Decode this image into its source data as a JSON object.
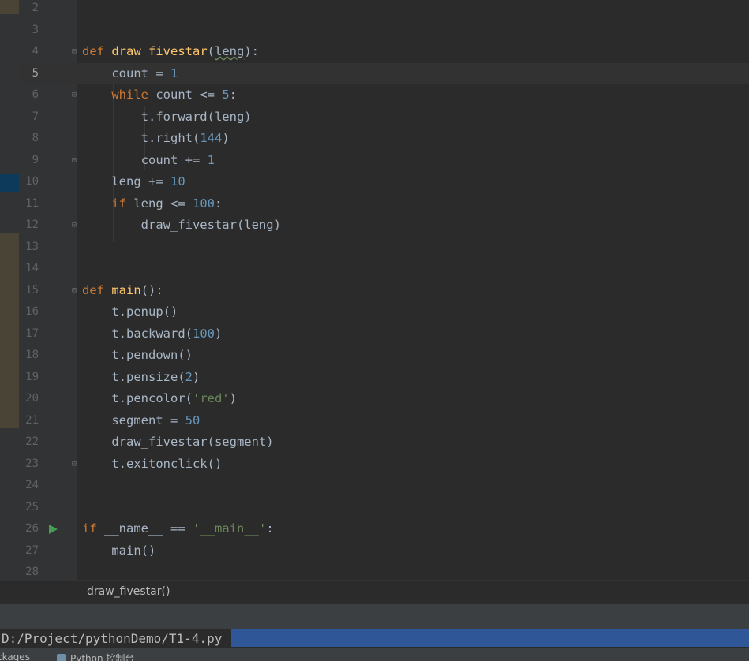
{
  "editor": {
    "current_line": "5",
    "lines": [
      {
        "num": "2"
      },
      {
        "num": "3"
      },
      {
        "num": "4",
        "t1": "def",
        "t2": " ",
        "t3": "draw_fivestar",
        "t4": "(",
        "t5": "leng",
        "t6": "):"
      },
      {
        "num": "5",
        "t1": "    count = ",
        "t2": "1"
      },
      {
        "num": "6",
        "t1": "    ",
        "t2": "while",
        "t3": " count <= ",
        "t4": "5",
        "t5": ":"
      },
      {
        "num": "7",
        "t1": "        t.forward(leng)"
      },
      {
        "num": "8",
        "t1": "        t.right(",
        "t2": "144",
        "t3": ")"
      },
      {
        "num": "9",
        "t1": "        count += ",
        "t2": "1"
      },
      {
        "num": "10",
        "t1": "    leng += ",
        "t2": "10"
      },
      {
        "num": "11",
        "t1": "    ",
        "t2": "if",
        "t3": " leng <= ",
        "t4": "100",
        "t5": ":"
      },
      {
        "num": "12",
        "t1": "        draw_fivestar(leng)"
      },
      {
        "num": "13"
      },
      {
        "num": "14"
      },
      {
        "num": "15",
        "t1": "def",
        "t2": " ",
        "t3": "main",
        "t4": "():"
      },
      {
        "num": "16",
        "t1": "    t.penup()"
      },
      {
        "num": "17",
        "t1": "    t.backward(",
        "t2": "100",
        "t3": ")"
      },
      {
        "num": "18",
        "t1": "    t.pendown()"
      },
      {
        "num": "19",
        "t1": "    t.pensize(",
        "t2": "2",
        "t3": ")"
      },
      {
        "num": "20",
        "t1": "    t.pencolor(",
        "t2": "'red'",
        "t3": ")"
      },
      {
        "num": "21",
        "t1": "    segment = ",
        "t2": "50"
      },
      {
        "num": "22",
        "t1": "    draw_fivestar(segment)"
      },
      {
        "num": "23",
        "t1": "    t.exitonclick()"
      },
      {
        "num": "24"
      },
      {
        "num": "25"
      },
      {
        "num": "26",
        "t1": "if",
        "t2": " __name__ == ",
        "t3": "'__main__'",
        "t4": ":"
      },
      {
        "num": "27",
        "t1": "    main()"
      },
      {
        "num": "28"
      }
    ]
  },
  "breadcrumb": {
    "label": "draw_fivestar()"
  },
  "terminal": {
    "path": "D:/Project/pythonDemo/T1-4.py"
  },
  "status_bar": {
    "packages_label": "ckages",
    "console_label": "Python 控制台"
  },
  "colors": {
    "keyword": "#cc7832",
    "function": "#ffc66d",
    "number": "#6897bb",
    "string": "#6a8759",
    "text": "#a9b7c6",
    "selection": "#2f5798",
    "run_icon": "#499c54"
  },
  "icons": {
    "run": "run-triangle-icon",
    "fold": "fold-marker-icon",
    "python": "python-icon"
  }
}
